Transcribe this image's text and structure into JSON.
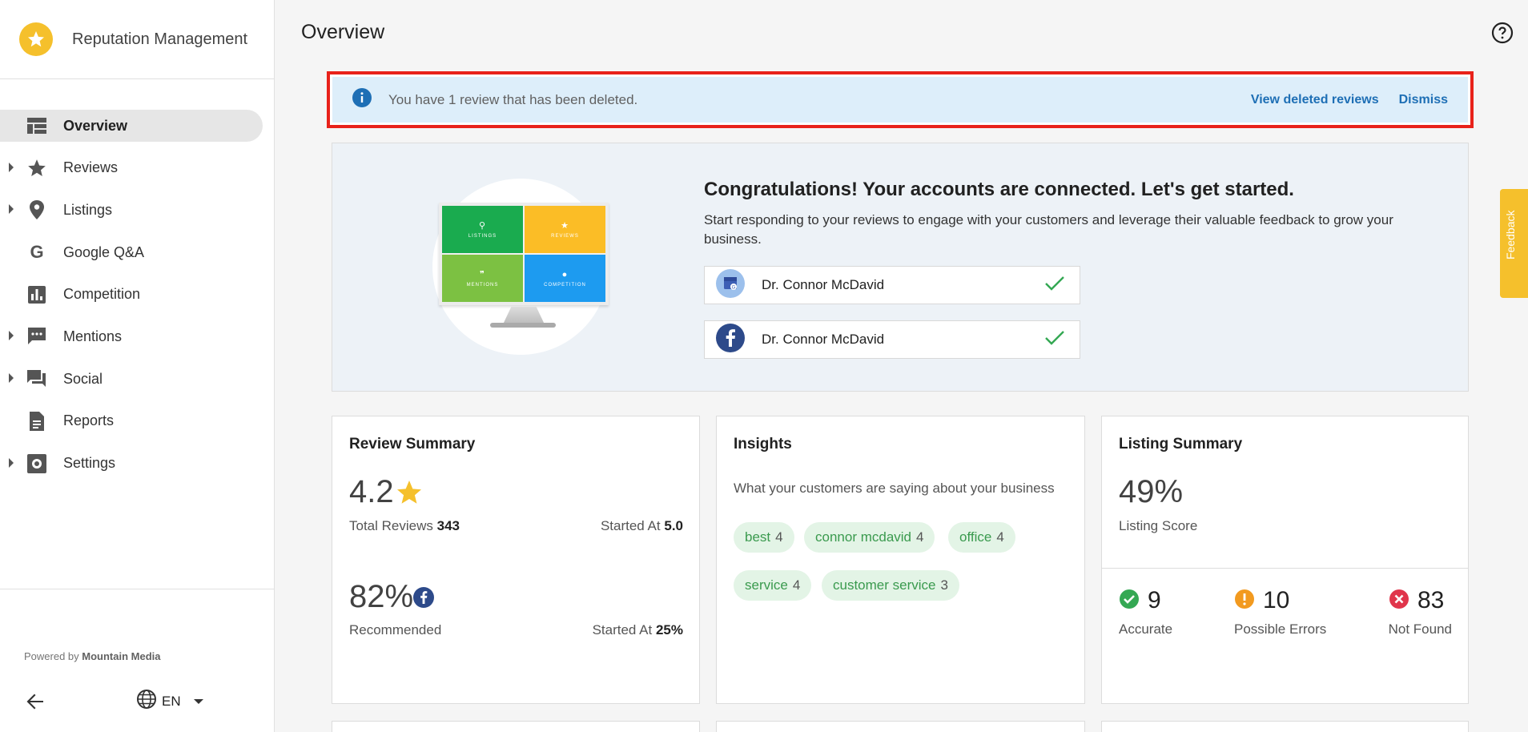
{
  "sidebar": {
    "brand": "Reputation Management",
    "items": [
      {
        "label": "Overview",
        "icon": "dashboard-icon"
      },
      {
        "label": "Reviews",
        "icon": "star-icon"
      },
      {
        "label": "Listings",
        "icon": "location-pin-icon"
      },
      {
        "label": "Google Q&A",
        "icon": "google-icon"
      },
      {
        "label": "Competition",
        "icon": "bar-chart-icon"
      },
      {
        "label": "Mentions",
        "icon": "comment-icon"
      },
      {
        "label": "Social",
        "icon": "forum-icon"
      },
      {
        "label": "Reports",
        "icon": "document-icon"
      },
      {
        "label": "Settings",
        "icon": "settings-icon"
      }
    ],
    "powered_prefix": "Powered by",
    "powered_brand": "Mountain Media",
    "language": "EN"
  },
  "header": {
    "title": "Overview"
  },
  "alert": {
    "message": "You have 1 review that has been deleted.",
    "view_link": "View deleted reviews",
    "dismiss_link": "Dismiss"
  },
  "connected": {
    "title": "Congratulations! Your accounts are connected. Let's get started.",
    "description": "Start responding to your reviews to engage with your customers and leverage their valuable feedback to grow your business.",
    "accounts": [
      {
        "name": "Dr. Connor McDavid",
        "source": "google-my-business"
      },
      {
        "name": "Dr. Connor McDavid",
        "source": "facebook"
      }
    ],
    "illustration_tiles": [
      "LISTINGS",
      "REVIEWS",
      "MENTIONS",
      "COMPETITION"
    ]
  },
  "review_summary": {
    "title": "Review Summary",
    "rating": "4.2",
    "total_label": "Total Reviews",
    "total_value": "343",
    "started_label_1": "Started At",
    "started_value_1": "5.0",
    "recommended_pct": "82%",
    "recommended_label": "Recommended",
    "started_label_2": "Started At",
    "started_value_2": "25%"
  },
  "insights": {
    "title": "Insights",
    "subtitle": "What your customers are saying about your business",
    "chips": [
      {
        "term": "best",
        "count": "4"
      },
      {
        "term": "connor mcdavid",
        "count": "4"
      },
      {
        "term": "office",
        "count": "4"
      },
      {
        "term": "service",
        "count": "4"
      },
      {
        "term": "customer service",
        "count": "3"
      }
    ]
  },
  "listing_summary": {
    "title": "Listing Summary",
    "score": "49%",
    "score_label": "Listing Score",
    "accurate_value": "9",
    "accurate_label": "Accurate",
    "errors_value": "10",
    "errors_label": "Possible Errors",
    "notfound_value": "83",
    "notfound_label": "Not Found"
  },
  "feedback_tab": "Feedback",
  "colors": {
    "accent": "#f5c02c",
    "link": "#1e6fb5",
    "alert_bg": "#ddeefa",
    "success": "#34a853",
    "warning": "#f29a1f",
    "danger": "#e0354b"
  }
}
